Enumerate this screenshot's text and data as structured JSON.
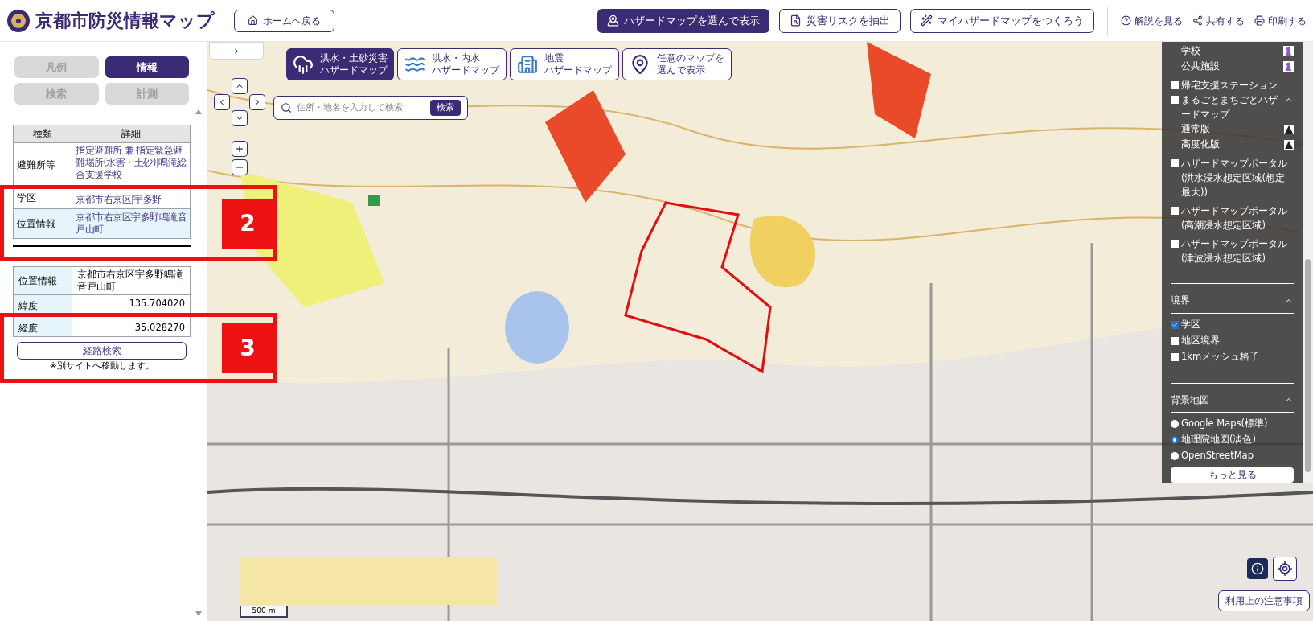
{
  "header": {
    "title": "京都市防災情報マップ",
    "home_button": "ホームへ戻る",
    "actions": [
      {
        "label": "ハザードマップを選んで表示",
        "kind": "primary"
      },
      {
        "label": "災害リスクを抽出",
        "kind": "outline"
      },
      {
        "label": "マイハザードマップをつくろう",
        "kind": "outline"
      }
    ],
    "links": [
      {
        "label": "解説を見る",
        "kind": "help"
      },
      {
        "label": "共有する",
        "kind": "share"
      },
      {
        "label": "印刷する",
        "kind": "print"
      }
    ]
  },
  "sidebar": {
    "tabs": [
      {
        "label": "凡例",
        "selected": false
      },
      {
        "label": "情報",
        "selected": true
      },
      {
        "label": "検索",
        "selected": false
      },
      {
        "label": "計測",
        "selected": false
      }
    ],
    "info_table": {
      "columns": [
        "種類",
        "詳細"
      ],
      "rows": [
        {
          "label": "避難所等",
          "value": "指定避難所 兼 指定緊急避難場所(水害・土砂)|鳴滝総合支援学校"
        },
        {
          "label": "学区",
          "value": "京都市右京区|宇多野"
        },
        {
          "label": "位置情報",
          "value": "京都市右京区宇多野鳴滝音戸山町"
        }
      ]
    },
    "location_table": {
      "rows": [
        {
          "label": "位置情報",
          "value": "京都市右京区宇多野鳴滝音戸山町"
        },
        {
          "label": "緯度",
          "value": "135.704020"
        },
        {
          "label": "経度",
          "value": "35.028270"
        }
      ]
    },
    "route_button": "経路検索",
    "note": "※別サイトへ移動します。"
  },
  "map": {
    "hazard_tabs": [
      {
        "lines": [
          "洪水・土砂災害",
          "ハザードマップ"
        ],
        "selected": true,
        "kind": "landslide"
      },
      {
        "lines": [
          "洪水・内水",
          "ハザードマップ"
        ],
        "selected": false,
        "kind": "flood"
      },
      {
        "lines": [
          "地震",
          "ハザードマップ"
        ],
        "selected": false,
        "kind": "quake"
      },
      {
        "lines": [
          "任意のマップを",
          "選んで表示"
        ],
        "selected": false,
        "kind": "custom"
      }
    ],
    "search": {
      "placeholder": "住所・地名を入力して検索",
      "button": "検索"
    },
    "expand_tab": "›",
    "scale": "500 m",
    "notice_button": "利用上の注意事項"
  },
  "layer_panel": {
    "items": [
      {
        "kind": "legend",
        "label": "学校"
      },
      {
        "kind": "legend",
        "label": "公共施設"
      },
      {
        "kind": "checkbox",
        "label": "帰宅支援ステーション",
        "checked": false
      },
      {
        "kind": "group",
        "label": "まるごとまちごとハザードマップ",
        "checked": false,
        "expanded": true,
        "children": [
          {
            "label": "通常版"
          },
          {
            "label": "高度化版"
          }
        ]
      },
      {
        "kind": "checkbox",
        "label": "ハザードマップポータル(洪水浸水想定区域(想定最大))",
        "checked": false
      },
      {
        "kind": "checkbox",
        "label": "ハザードマップポータル(高潮浸水想定区域)",
        "checked": false
      },
      {
        "kind": "checkbox",
        "label": "ハザードマップポータル(津波浸水想定区域)",
        "checked": false
      }
    ],
    "sections": [
      {
        "title": "境界",
        "expanded": true,
        "kind": "checkbox",
        "options": [
          {
            "label": "学区",
            "selected": true
          },
          {
            "label": "地区境界",
            "selected": false
          },
          {
            "label": "1kmメッシュ格子",
            "selected": false
          }
        ]
      },
      {
        "title": "背景地図",
        "expanded": true,
        "kind": "radio",
        "options": [
          {
            "label": "Google Maps(標準)",
            "selected": false
          },
          {
            "label": "地理院地図(淡色)",
            "selected": true
          },
          {
            "label": "OpenStreetMap",
            "selected": false
          }
        ]
      }
    ],
    "more_button": "もっと見る"
  },
  "annotations": [
    {
      "label": "2"
    },
    {
      "label": "3"
    }
  ]
}
